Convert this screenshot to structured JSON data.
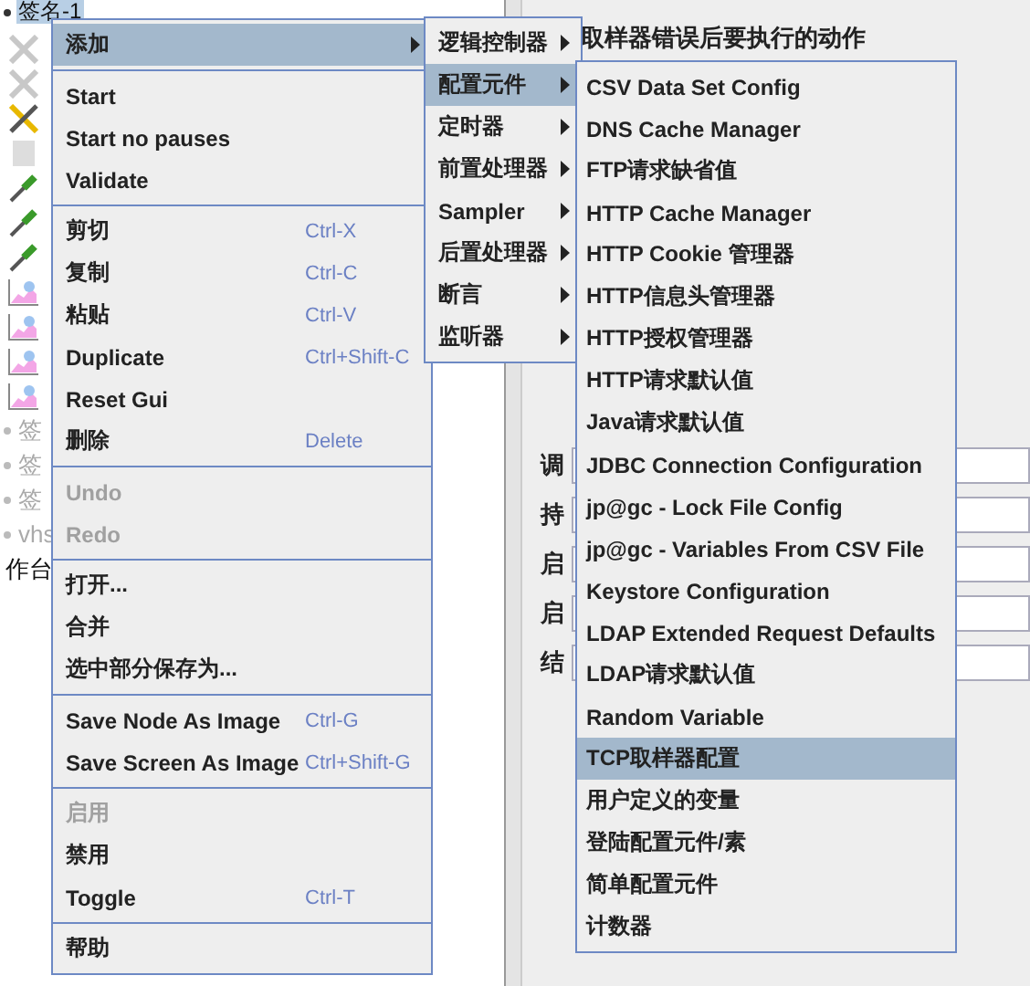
{
  "tree": [
    {
      "kind": "node",
      "label": "签名-1",
      "selected": true,
      "disabled": false
    },
    {
      "kind": "cross",
      "selected": false,
      "disabled": true
    },
    {
      "kind": "cross",
      "selected": false,
      "disabled": true
    },
    {
      "kind": "tools",
      "selected": false,
      "disabled": false
    },
    {
      "kind": "document",
      "selected": false,
      "disabled": true
    },
    {
      "kind": "pipette",
      "selected": false,
      "disabled": false
    },
    {
      "kind": "pipette",
      "selected": false,
      "disabled": false
    },
    {
      "kind": "pipette",
      "selected": false,
      "disabled": false
    },
    {
      "kind": "graph",
      "selected": false,
      "disabled": false
    },
    {
      "kind": "graph",
      "selected": false,
      "disabled": false
    },
    {
      "kind": "graph",
      "selected": false,
      "disabled": false
    },
    {
      "kind": "graph",
      "selected": false,
      "disabled": false
    },
    {
      "kind": "node",
      "label": "签",
      "selected": false,
      "disabled": true
    },
    {
      "kind": "node",
      "label": "签",
      "selected": false,
      "disabled": true
    },
    {
      "kind": "node",
      "label": "签",
      "selected": false,
      "disabled": true
    },
    {
      "kind": "node",
      "label": "vhs",
      "selected": false,
      "disabled": true
    },
    {
      "kind": "text",
      "label": "作台",
      "selected": false,
      "disabled": false
    }
  ],
  "panel": {
    "section_title": "取样器错误后要执行的动作",
    "form_labels": [
      "调",
      "持",
      "启",
      "启",
      "结"
    ]
  },
  "menu": [
    {
      "kind": "item",
      "label": "添加",
      "selected": true,
      "disabled": false,
      "submenu": true
    },
    {
      "kind": "separator"
    },
    {
      "kind": "item",
      "label": "Start",
      "selected": false,
      "disabled": false,
      "submenu": false
    },
    {
      "kind": "item",
      "label": "Start no pauses",
      "selected": false,
      "disabled": false,
      "submenu": false
    },
    {
      "kind": "item",
      "label": "Validate",
      "selected": false,
      "disabled": false,
      "submenu": false
    },
    {
      "kind": "separator"
    },
    {
      "kind": "item",
      "label": "剪切",
      "shortcut": "Ctrl-X",
      "selected": false,
      "disabled": false,
      "submenu": false
    },
    {
      "kind": "item",
      "label": "复制",
      "shortcut": "Ctrl-C",
      "selected": false,
      "disabled": false,
      "submenu": false
    },
    {
      "kind": "item",
      "label": "粘贴",
      "shortcut": "Ctrl-V",
      "selected": false,
      "disabled": false,
      "submenu": false
    },
    {
      "kind": "item",
      "label": "Duplicate",
      "shortcut": "Ctrl+Shift-C",
      "selected": false,
      "disabled": false,
      "submenu": false
    },
    {
      "kind": "item",
      "label": "Reset Gui",
      "selected": false,
      "disabled": false,
      "submenu": false
    },
    {
      "kind": "item",
      "label": "删除",
      "shortcut": "Delete",
      "selected": false,
      "disabled": false,
      "submenu": false
    },
    {
      "kind": "separator"
    },
    {
      "kind": "item",
      "label": "Undo",
      "selected": false,
      "disabled": true,
      "submenu": false
    },
    {
      "kind": "item",
      "label": "Redo",
      "selected": false,
      "disabled": true,
      "submenu": false
    },
    {
      "kind": "separator"
    },
    {
      "kind": "item",
      "label": "打开...",
      "selected": false,
      "disabled": false,
      "submenu": false
    },
    {
      "kind": "item",
      "label": "合并",
      "selected": false,
      "disabled": false,
      "submenu": false
    },
    {
      "kind": "item",
      "label": "选中部分保存为...",
      "selected": false,
      "disabled": false,
      "submenu": false
    },
    {
      "kind": "separator"
    },
    {
      "kind": "item",
      "label": "Save Node As Image",
      "shortcut": "Ctrl-G",
      "selected": false,
      "disabled": false,
      "submenu": false
    },
    {
      "kind": "item",
      "label": "Save Screen As Image",
      "shortcut": "Ctrl+Shift-G",
      "selected": false,
      "disabled": false,
      "submenu": false
    },
    {
      "kind": "separator"
    },
    {
      "kind": "item",
      "label": "启用",
      "selected": false,
      "disabled": true,
      "submenu": false
    },
    {
      "kind": "item",
      "label": "禁用",
      "selected": false,
      "disabled": false,
      "submenu": false
    },
    {
      "kind": "item",
      "label": "Toggle",
      "shortcut": "Ctrl-T",
      "selected": false,
      "disabled": false,
      "submenu": false
    },
    {
      "kind": "separator"
    },
    {
      "kind": "item",
      "label": "帮助",
      "selected": false,
      "disabled": false,
      "submenu": false
    }
  ],
  "add_submenu": [
    {
      "label": "逻辑控制器",
      "selected": false,
      "submenu": true
    },
    {
      "label": "配置元件",
      "selected": true,
      "submenu": true
    },
    {
      "label": "定时器",
      "selected": false,
      "submenu": true
    },
    {
      "label": "前置处理器",
      "selected": false,
      "submenu": true
    },
    {
      "label": "Sampler",
      "selected": false,
      "submenu": true
    },
    {
      "label": "后置处理器",
      "selected": false,
      "submenu": true
    },
    {
      "label": "断言",
      "selected": false,
      "submenu": true
    },
    {
      "label": "监听器",
      "selected": false,
      "submenu": true
    }
  ],
  "config_submenu": [
    {
      "label": "CSV Data Set Config",
      "selected": false
    },
    {
      "label": "DNS Cache Manager",
      "selected": false
    },
    {
      "label": "FTP请求缺省值",
      "selected": false
    },
    {
      "label": "HTTP Cache Manager",
      "selected": false
    },
    {
      "label": "HTTP Cookie 管理器",
      "selected": false
    },
    {
      "label": "HTTP信息头管理器",
      "selected": false
    },
    {
      "label": "HTTP授权管理器",
      "selected": false
    },
    {
      "label": "HTTP请求默认值",
      "selected": false
    },
    {
      "label": "Java请求默认值",
      "selected": false
    },
    {
      "label": "JDBC Connection Configuration",
      "selected": false
    },
    {
      "label": "jp@gc - Lock File Config",
      "selected": false
    },
    {
      "label": "jp@gc - Variables From CSV File",
      "selected": false
    },
    {
      "label": "Keystore Configuration",
      "selected": false
    },
    {
      "label": "LDAP Extended Request Defaults",
      "selected": false
    },
    {
      "label": "LDAP请求默认值",
      "selected": false
    },
    {
      "label": "Random Variable",
      "selected": false
    },
    {
      "label": "TCP取样器配置",
      "selected": true
    },
    {
      "label": "用户定义的变量",
      "selected": false
    },
    {
      "label": "登陆配置元件/素",
      "selected": false
    },
    {
      "label": "简单配置元件",
      "selected": false
    },
    {
      "label": "计数器",
      "selected": false
    }
  ]
}
